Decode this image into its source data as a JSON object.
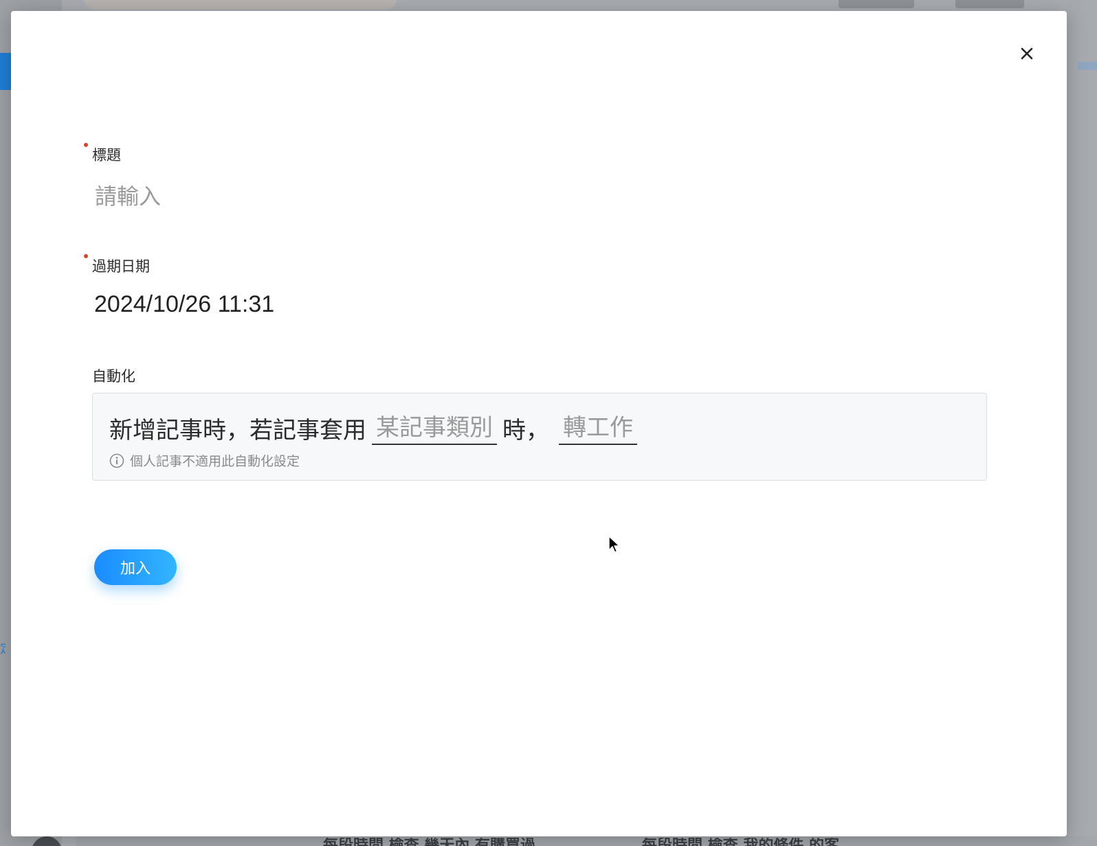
{
  "modal": {
    "close_label": "×"
  },
  "form": {
    "title": {
      "label": "標題",
      "placeholder": "請輸入",
      "value": "",
      "required": true
    },
    "due_date": {
      "label": "過期日期",
      "value": "2024/10/26 11:31",
      "required": true
    },
    "automation": {
      "label": "自動化",
      "sentence_prefix": "新增記事時，若記事套用",
      "category_select_placeholder": "某記事類別",
      "sentence_middle": "時，",
      "action_select_placeholder": "轉工作",
      "hint": "個人記事不適用此自動化設定"
    },
    "submit_label": "加入"
  },
  "background": {
    "bottom_texts": [
      "每段時間 檢查 幾天內 有購買過",
      "每段時間 檢查 我的條件 的客"
    ]
  },
  "colors": {
    "required": "#d9452b",
    "primary_button_start": "#1a8cff",
    "primary_button_end": "#33b5ff",
    "placeholder": "#9a9a9a",
    "automation_box_bg": "#f7f8fa"
  },
  "icons": {
    "close": "close-icon",
    "info": "info-icon"
  }
}
